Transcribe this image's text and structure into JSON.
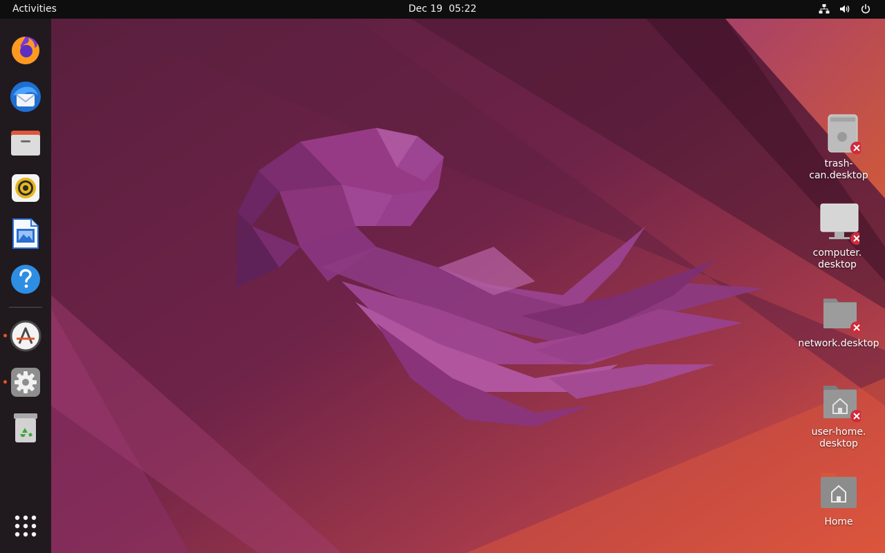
{
  "topbar": {
    "activities": "Activities",
    "date": "Dec 19",
    "time": "05:22"
  },
  "tray": {
    "icons": [
      "network-icon",
      "volume-icon",
      "power-icon"
    ]
  },
  "dock": {
    "apps": [
      {
        "id": "firefox",
        "icon": "firefox-icon",
        "running": false
      },
      {
        "id": "thunderbird",
        "icon": "thunderbird-icon",
        "running": false
      },
      {
        "id": "files",
        "icon": "files-icon",
        "running": false
      },
      {
        "id": "rhythmbox",
        "icon": "rhythmbox-icon",
        "running": false
      },
      {
        "id": "libreoffice-writer",
        "icon": "writer-icon",
        "running": false
      },
      {
        "id": "help",
        "icon": "help-icon",
        "running": false
      },
      {
        "id": "software",
        "icon": "software-icon",
        "running": true
      },
      {
        "id": "settings",
        "icon": "settings-icon",
        "running": true
      },
      {
        "id": "trash",
        "icon": "trash-icon",
        "running": false
      }
    ],
    "show_apps_icon": "app-grid-icon"
  },
  "desktop": {
    "icons": [
      {
        "line1": "trash-can.desktop",
        "line2": "",
        "icon": "trash-file-icon",
        "broken": true
      },
      {
        "line1": "computer.",
        "line2": "desktop",
        "icon": "computer-file-icon",
        "broken": true
      },
      {
        "line1": "network.desktop",
        "line2": "",
        "icon": "network-file-icon",
        "broken": true
      },
      {
        "line1": "user-home.",
        "line2": "desktop",
        "icon": "home-file-icon",
        "broken": true
      },
      {
        "line1": "Home",
        "line2": "",
        "icon": "home-folder-icon",
        "broken": false
      }
    ]
  },
  "colors": {
    "accent": "#e95420",
    "topbar": "#0e0e0e",
    "dock": "#201a1e",
    "wallpaper_base": "#6a2447"
  }
}
